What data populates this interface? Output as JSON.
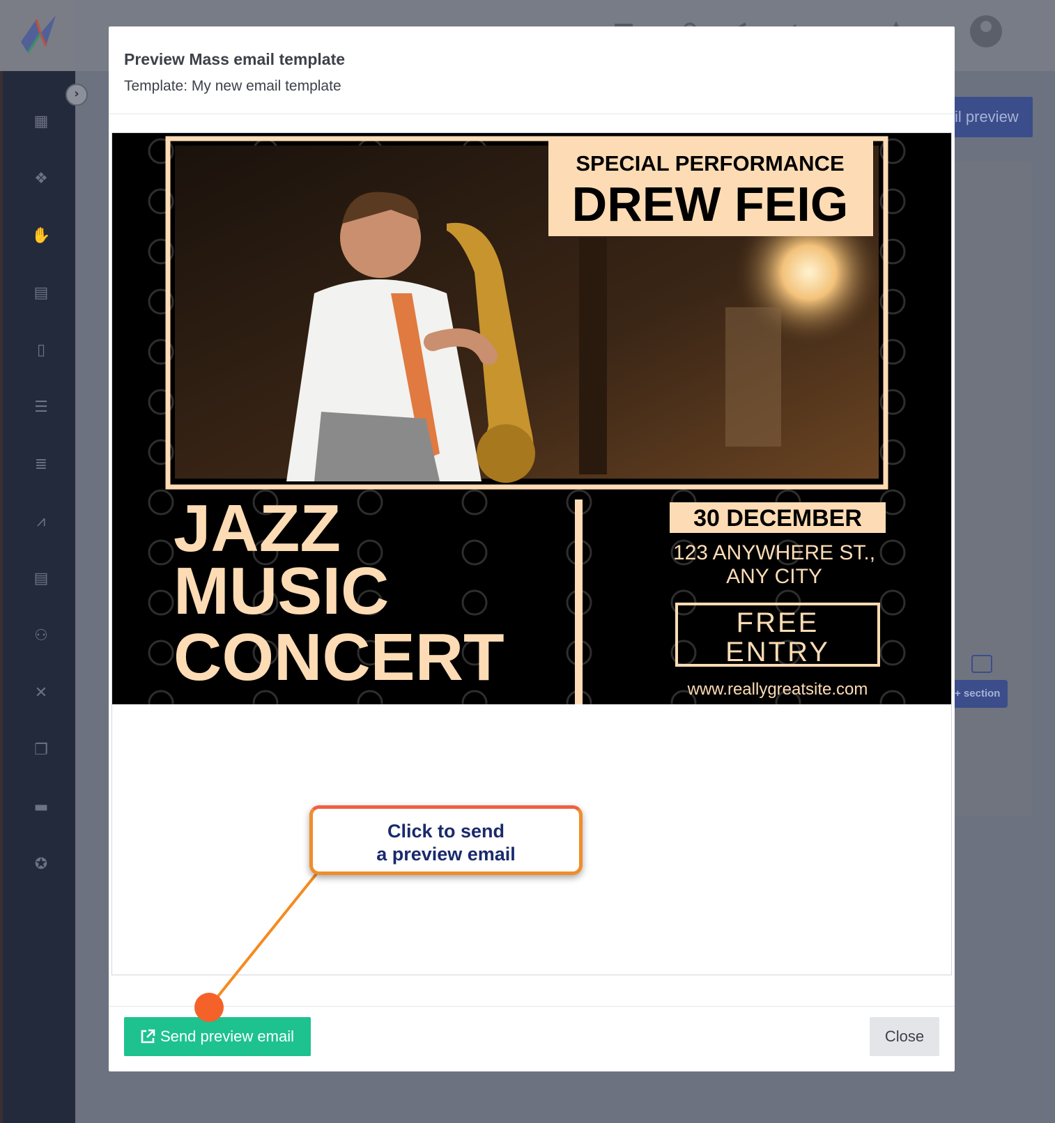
{
  "modal": {
    "title": "Preview Mass email template",
    "subtitle": "Template: My new email template"
  },
  "flyer": {
    "overline": "SPECIAL PERFORMANCE",
    "headline": "DREW FEIG",
    "event_lines": [
      "JAZZ",
      "MUSIC",
      "CONCERT"
    ],
    "date": "30 DECEMBER",
    "address_line1": "123 ANYWHERE ST.,",
    "address_line2": "ANY CITY",
    "entry_line1": "FREE",
    "entry_line2": "ENTRY",
    "website": "www.reallygreatsite.com",
    "colors": {
      "background": "#000000",
      "accent": "#fddcb5"
    }
  },
  "footer": {
    "send_label": "Send preview email",
    "close_label": "Close"
  },
  "background": {
    "preview_button_label": "il preview",
    "section_button_label": "+ section"
  },
  "callout": {
    "line1": "Click to send",
    "line2": "a preview email"
  },
  "colors": {
    "send_button": "#1dc28f",
    "sidebar": "#232a3c",
    "callout_border": "#f08d2b",
    "callout_text": "#1a2a6c"
  },
  "sidebar": {
    "icons": [
      "calendar-star-icon",
      "cubes-icon",
      "hand-icon",
      "id-card-icon",
      "invoice-icon",
      "checklist-icon",
      "campaign-list-icon",
      "chart-line-icon",
      "contact-card-icon",
      "people-icon",
      "tools-icon",
      "documents-icon",
      "sofa-icon",
      "lifebuoy-icon"
    ]
  }
}
